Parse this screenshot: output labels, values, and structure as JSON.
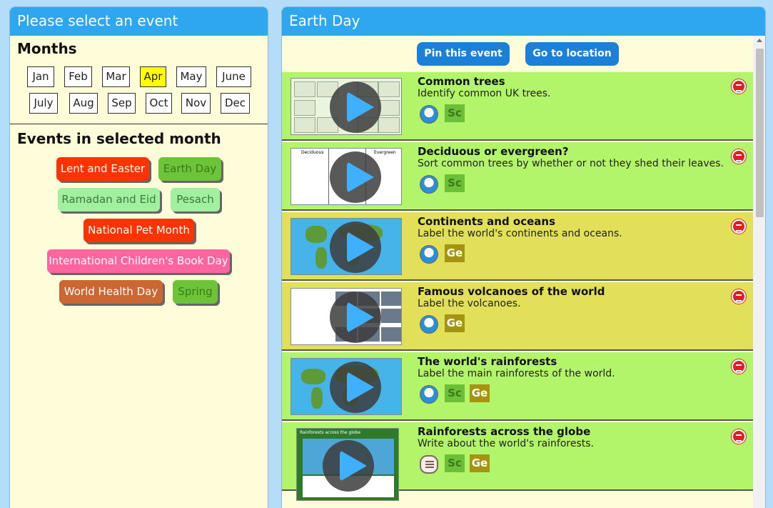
{
  "left": {
    "header": "Please select an event",
    "months_title": "Months",
    "months": [
      "Jan",
      "Feb",
      "Mar",
      "Apr",
      "May",
      "June",
      "July",
      "Aug",
      "Sep",
      "Oct",
      "Nov",
      "Dec"
    ],
    "selected_month": "Apr",
    "events_title": "Events in selected month",
    "events": [
      {
        "label": "Lent and Easter",
        "color": "#ff3300",
        "text": "#ffffff"
      },
      {
        "label": "Earth Day",
        "color": "#6dc438",
        "text": "#3a7a1a"
      },
      {
        "label": "Ramadan and Eid",
        "color": "#a0f0a0",
        "text": "#3a7a3a"
      },
      {
        "label": "Pesach",
        "color": "#a0f0a0",
        "text": "#3a7a3a"
      },
      {
        "label": "National Pet Month",
        "color": "#ff3300",
        "text": "#ffffff"
      },
      {
        "label": "International Children's Book Day",
        "color": "#ff66a0",
        "text": "#ffffff"
      },
      {
        "label": "World Health Day",
        "color": "#cc6633",
        "text": "#ffffff"
      },
      {
        "label": "Spring",
        "color": "#6dc438",
        "text": "#3a7a1a"
      }
    ]
  },
  "right": {
    "header": "Earth Day",
    "pin_label": "Pin this event",
    "goto_label": "Go to location",
    "activities": [
      {
        "title": "Common trees",
        "desc": "Identify common UK trees.",
        "subjects": [
          "Sc"
        ],
        "icon": "ipad-icon"
      },
      {
        "title": "Deciduous or evergreen?",
        "desc": "Sort common trees by whether or not they shed their leaves.",
        "subjects": [
          "Sc"
        ],
        "icon": "ipad-icon"
      },
      {
        "title": "Continents and oceans",
        "desc": "Label the world's continents and oceans.",
        "subjects": [
          "Ge"
        ],
        "icon": "ipad-icon"
      },
      {
        "title": "Famous volcanoes of the world",
        "desc": "Label the volcanoes.",
        "subjects": [
          "Ge"
        ],
        "icon": "ipad-icon"
      },
      {
        "title": "The world's rainforests",
        "desc": "Label the main rainforests of the world.",
        "subjects": [
          "Sc",
          "Ge"
        ],
        "icon": "ipad-icon"
      },
      {
        "title": "Rainforests across the globe",
        "desc": "Write about the world's rainforests.",
        "subjects": [
          "Sc",
          "Ge"
        ],
        "icon": "document-icon"
      }
    ],
    "thumb_labels": {
      "deciduous": "Deciduous",
      "evergreen": "Evergreen",
      "rainforest_sheet": "Rainforests across the globe"
    }
  }
}
